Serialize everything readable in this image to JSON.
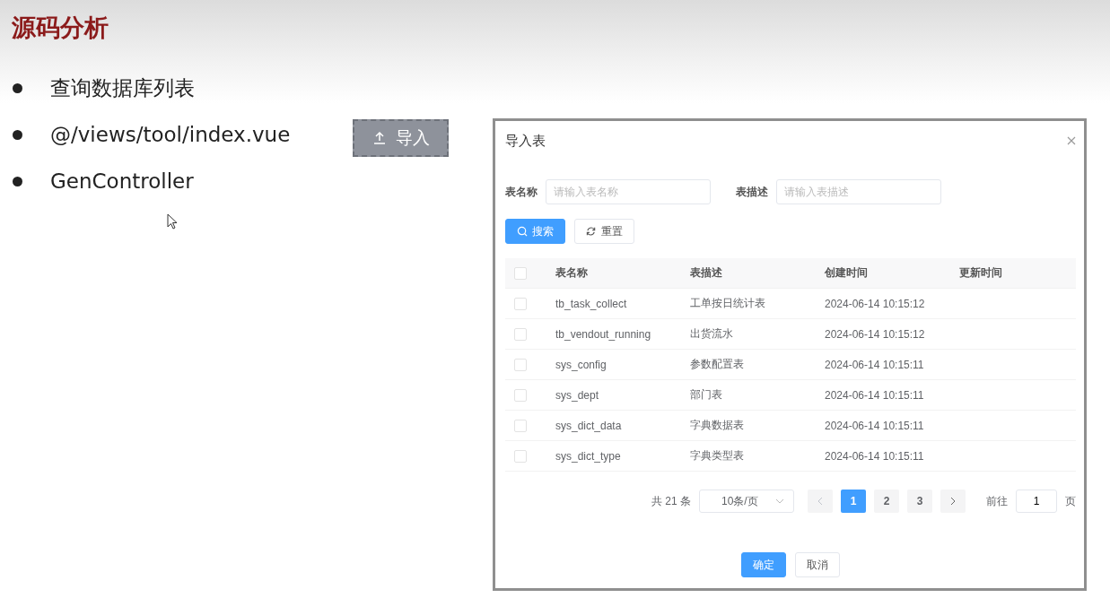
{
  "slide": {
    "title": "源码分析",
    "bullets": [
      "查询数据库列表",
      "@/views/tool/index.vue",
      "GenController"
    ]
  },
  "import_button": {
    "label": "导入"
  },
  "dialog": {
    "title": "导入表",
    "filters": [
      {
        "label": "表名称",
        "placeholder": "请输入表名称"
      },
      {
        "label": "表描述",
        "placeholder": "请输入表描述"
      }
    ],
    "buttons": [
      {
        "kind": "primary",
        "label": "搜索"
      },
      {
        "kind": "default",
        "label": "重置"
      }
    ],
    "table": {
      "all_checked": false,
      "columns": [
        "表名称",
        "表描述",
        "创建时间",
        "更新时间"
      ],
      "rows": [
        {
          "checked": false,
          "cells": [
            "tb_task_collect",
            "工单按日统计表",
            "2024-06-14 10:15:12"
          ]
        },
        {
          "checked": false,
          "cells": [
            "tb_vendout_running",
            "出货流水",
            "2024-06-14 10:15:12"
          ]
        },
        {
          "checked": false,
          "cells": [
            "sys_config",
            "参数配置表",
            "2024-06-14 10:15:11"
          ]
        },
        {
          "checked": false,
          "cells": [
            "sys_dept",
            "部门表",
            "2024-06-14 10:15:11"
          ]
        },
        {
          "checked": false,
          "cells": [
            "sys_dict_data",
            "字典数据表",
            "2024-06-14 10:15:11"
          ]
        },
        {
          "checked": false,
          "cells": [
            "sys_dict_type",
            "字典类型表",
            "2024-06-14 10:15:11"
          ]
        }
      ]
    },
    "pagination": {
      "total": "共 21 条",
      "page_size": "10条/页",
      "pages": [
        {
          "label": "1",
          "selected": true
        },
        {
          "label": "2",
          "selected": false
        },
        {
          "label": "3",
          "selected": false
        }
      ],
      "goto_label": "前往",
      "goto_value": "1",
      "page_suffix": "页"
    },
    "footer": [
      {
        "kind": "primary",
        "label": "确定"
      },
      {
        "kind": "default",
        "label": "取消"
      }
    ]
  }
}
